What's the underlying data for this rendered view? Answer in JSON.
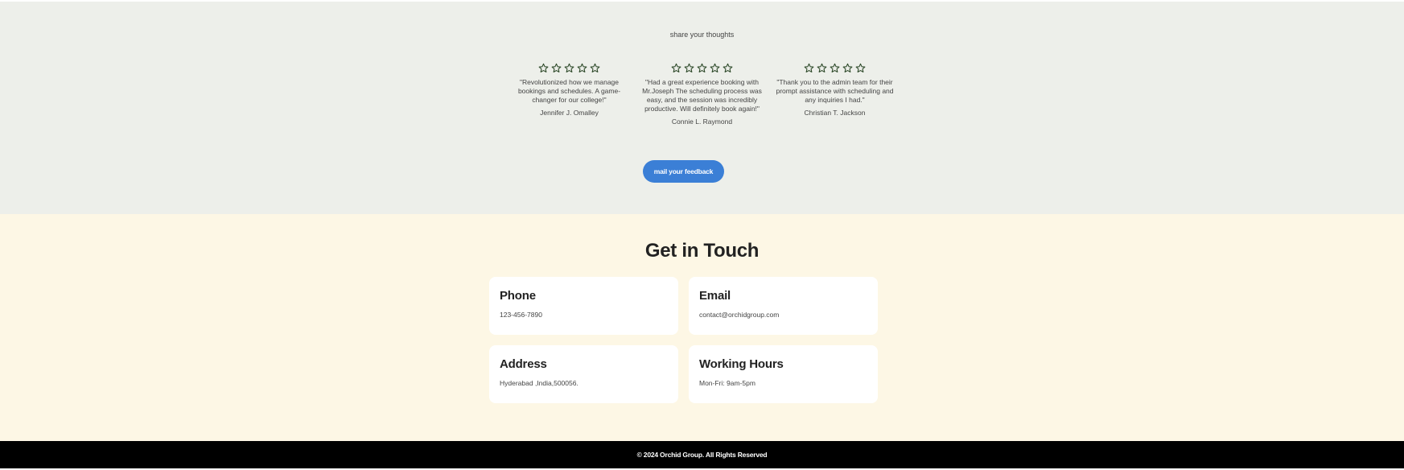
{
  "testimonials": {
    "heading": "share your thoughts",
    "items": [
      {
        "rating": 5,
        "quote": "\"Revolutionized how we manage bookings and schedules. A game-changer for our college!\"",
        "author": "Jennifer J. Omalley"
      },
      {
        "rating": 5,
        "quote": "\"Had a great experience booking with Mr.Joseph The scheduling process was easy, and the session was incredibly productive. Will definitely book again!\"",
        "author": "Connie L. Raymond"
      },
      {
        "rating": 5,
        "quote": "\"Thank you to the admin team for their prompt assistance with scheduling and any inquiries I had.\"",
        "author": "Christian T. Jackson"
      }
    ],
    "feedback_button": "mail your feedback"
  },
  "contact": {
    "title": "Get in Touch",
    "cards": [
      {
        "label": "Phone",
        "value": "123-456-7890"
      },
      {
        "label": "Email",
        "value": "contact@orchidgroup.com"
      },
      {
        "label": "Address",
        "value": "Hyderabad ,India,500056."
      },
      {
        "label": "Working Hours",
        "value": "Mon-Fri: 9am-5pm"
      }
    ]
  },
  "footer": {
    "copyright": "© 2024 Orchid Group. All Rights Reserved"
  },
  "colors": {
    "testimonial_bg": "#edefea",
    "contact_bg": "#fdf7e5",
    "button": "#3b7fd6",
    "star": "#2e4a2a",
    "footer_bg": "#000000"
  },
  "icons": {
    "star": "star-outline-icon"
  }
}
